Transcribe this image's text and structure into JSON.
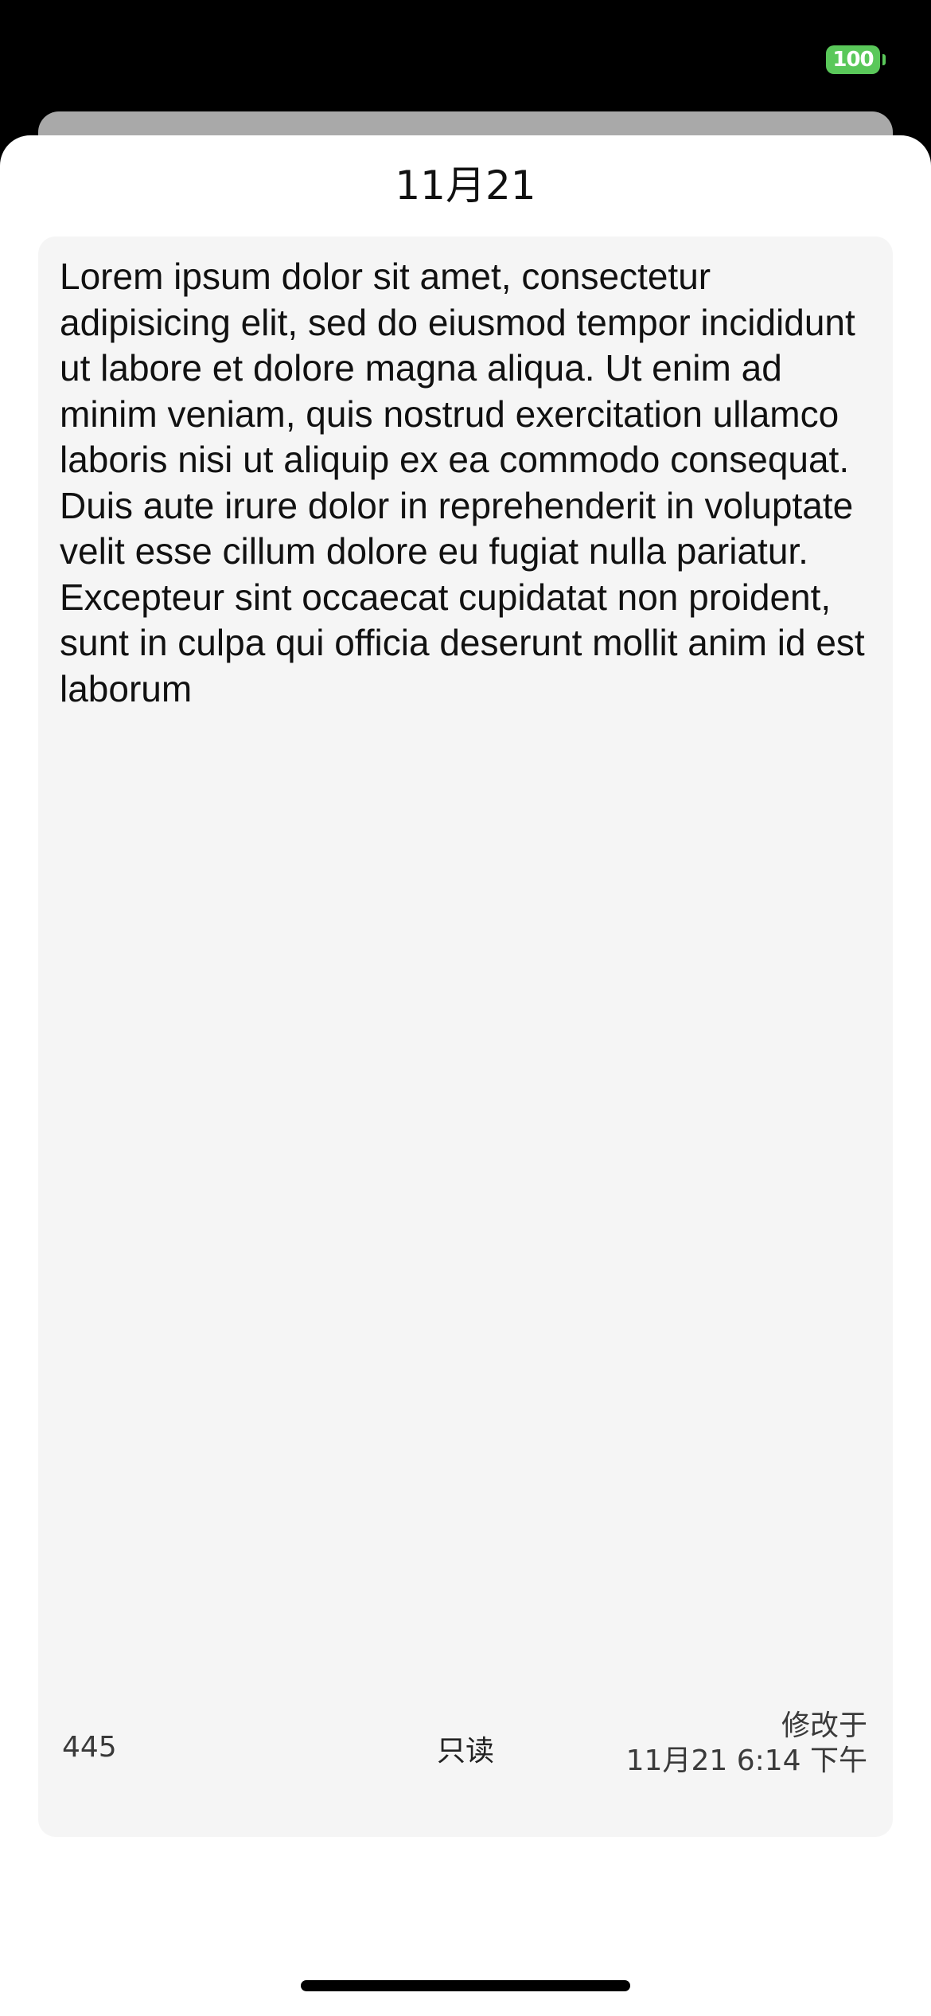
{
  "status_bar": {
    "battery_level": "100",
    "battery_color": "#5ac85a"
  },
  "sheet": {
    "title": "11月21",
    "body_text": "Lorem ipsum dolor sit amet, consectetur adipisicing elit, sed do eiusmod tempor incididunt ut labore et dolore magna aliqua. Ut enim ad minim veniam, quis nostrud exercitation ullamco laboris nisi ut aliquip ex ea commodo consequat. Duis aute irure dolor in reprehenderit in voluptate velit esse cillum dolore eu fugiat nulla pariatur. Excepteur sint occaecat cupidatat non proident, sunt in culpa qui officia deserunt mollit anim id est laborum"
  },
  "footer": {
    "char_count": "445",
    "readonly_label": "只读",
    "modified_label": "修改于",
    "modified_time": "11月21 6:14 下午"
  }
}
